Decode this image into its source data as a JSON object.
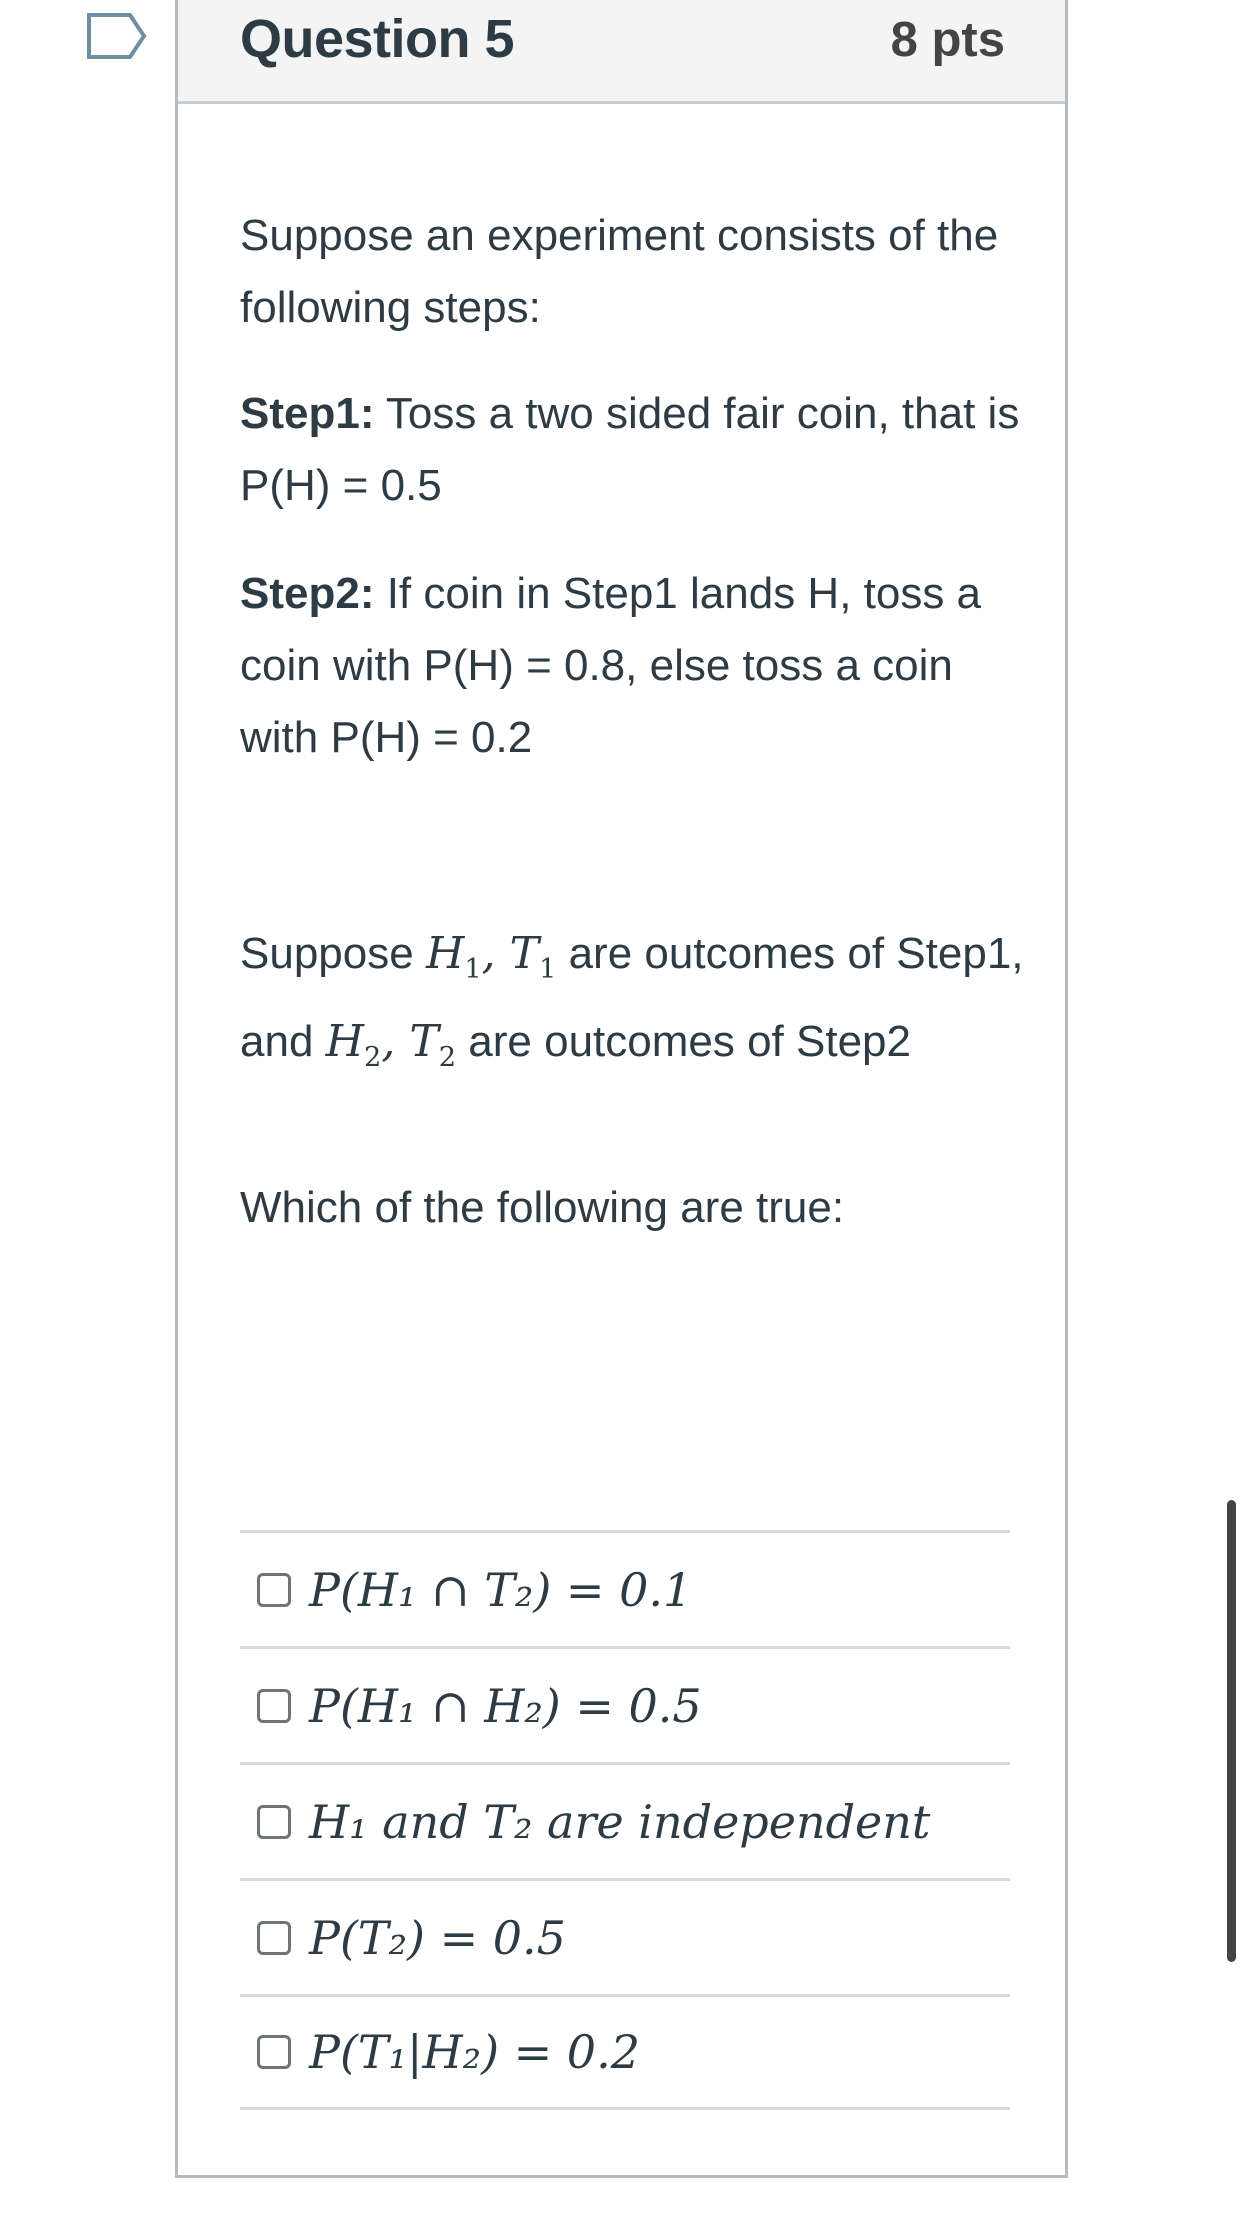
{
  "question": {
    "title": "Question 5",
    "points": "8 pts",
    "intro": "Suppose an experiment consists of the following steps:",
    "step1_label": "Step1:",
    "step1_text": " Toss a two sided fair coin, that is P(H) = 0.5",
    "step2_label": "Step2:",
    "step2_text": " If coin in Step1 lands H, toss a coin with P(H) = 0.8, else toss a coin with P(H) = 0.2",
    "outcomes_prefix": "Suppose ",
    "outcomes_mid": " are outcomes of Step1, and ",
    "outcomes_suffix": " are outcomes of Step2",
    "prompt": "Which of the following are true:"
  },
  "answers": [
    {
      "text": "P(H₁ ∩ T₂) = 0.1",
      "checked": false
    },
    {
      "text": "P(H₁ ∩ H₂) = 0.5",
      "checked": false
    },
    {
      "text": "H₁ and T₂ are independent",
      "checked": false
    },
    {
      "text": "P(T₂) = 0.5",
      "checked": false
    },
    {
      "text": "P(T₁|H₂) = 0.2",
      "checked": false
    }
  ],
  "icons": {
    "flag": "flag-icon"
  },
  "colors": {
    "text": "#2d3b45",
    "header_bg": "#f4f4f4",
    "border": "#b4bcc2"
  }
}
